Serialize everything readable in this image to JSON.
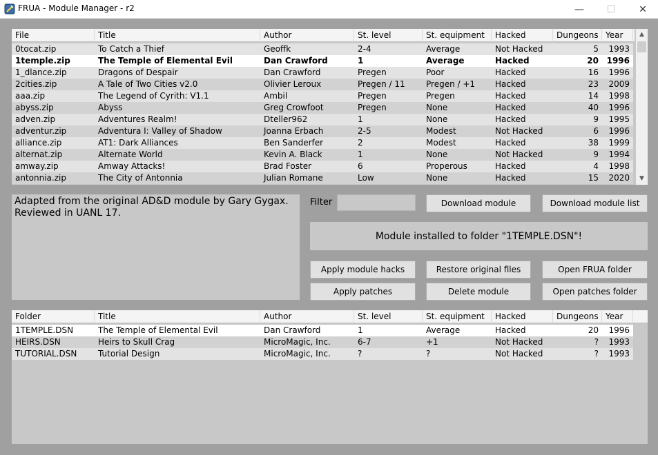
{
  "window": {
    "title": "FRUA - Module Manager - r2",
    "min_glyph": "—",
    "max_glyph": "☐",
    "close_glyph": "✕"
  },
  "modules": {
    "columns": [
      "File",
      "Title",
      "Author",
      "St. level",
      "St. equipment",
      "Hacked",
      "Dungeons",
      "Year"
    ],
    "selected_index": 1,
    "rows": [
      [
        "0tocat.zip",
        "To Catch a Thief",
        "Geoffk",
        "2-4",
        "Average",
        "Not Hacked",
        "5",
        "1993"
      ],
      [
        "1temple.zip",
        "The Temple of Elemental Evil",
        "Dan Crawford",
        "1",
        "Average",
        "Hacked",
        "20",
        "1996"
      ],
      [
        "1_dlance.zip",
        "Dragons of Despair",
        "Dan Crawford",
        "Pregen",
        "Poor",
        "Hacked",
        "16",
        "1996"
      ],
      [
        "2cities.zip",
        "A Tale of Two Cities v2.0",
        "Olivier Leroux",
        "Pregen / 11",
        "Pregen / +1",
        "Hacked",
        "23",
        "2009"
      ],
      [
        "aaa.zip",
        "The Legend of Cyrith: V1.1",
        "Ambil",
        "Pregen",
        "Pregen",
        "Hacked",
        "14",
        "1998"
      ],
      [
        "abyss.zip",
        "Abyss",
        "Greg Crowfoot",
        "Pregen",
        "None",
        "Hacked",
        "40",
        "1996"
      ],
      [
        "adven.zip",
        "Adventures Realm!",
        "Dteller962",
        "1",
        "None",
        "Hacked",
        "9",
        "1995"
      ],
      [
        "adventur.zip",
        "Adventura I: Valley of Shadow",
        "Joanna Erbach",
        "2-5",
        "Modest",
        "Not Hacked",
        "6",
        "1996"
      ],
      [
        "alliance.zip",
        "AT1: Dark Alliances",
        "Ben Sanderfer",
        "2",
        "Modest",
        "Hacked",
        "38",
        "1999"
      ],
      [
        "alternat.zip",
        "Alternate World",
        "Kevin A. Black",
        "1",
        "None",
        "Not Hacked",
        "9",
        "1994"
      ],
      [
        "amway.zip",
        "Amway Attacks!",
        "Brad Foster",
        "6",
        "Properous",
        "Hacked",
        "4",
        "1998"
      ],
      [
        "antonnia.zip",
        "The City of Antonnia",
        "Julian Romane",
        "Low",
        "None",
        "Hacked",
        "15",
        "2020"
      ]
    ]
  },
  "description": {
    "line1": "Adapted from the original AD&D module by Gary Gygax.",
    "line2": "Reviewed in UANL 17."
  },
  "filter": {
    "label": "Filter",
    "value": ""
  },
  "buttons": {
    "download_module": "Download module",
    "download_module_list": "Download module list",
    "apply_module_hacks": "Apply module hacks",
    "restore_original_files": "Restore original files",
    "open_frua_folder": "Open FRUA folder",
    "apply_patches": "Apply patches",
    "delete_module": "Delete module",
    "open_patches_folder": "Open patches folder"
  },
  "status": {
    "message": "Module installed to folder \"1TEMPLE.DSN\"!"
  },
  "installed": {
    "columns": [
      "Folder",
      "Title",
      "Author",
      "St. level",
      "St. equipment",
      "Hacked",
      "Dungeons",
      "Year"
    ],
    "selected_index": 0,
    "rows": [
      [
        "1TEMPLE.DSN",
        "The Temple of Elemental Evil",
        "Dan Crawford",
        "1",
        "Average",
        "Hacked",
        "20",
        "1996"
      ],
      [
        "HEIRS.DSN",
        "Heirs to Skull Crag",
        "MicroMagic, Inc.",
        "6-7",
        "+1",
        "Not Hacked",
        "?",
        "1993"
      ],
      [
        "TUTORIAL.DSN",
        "Tutorial Design",
        "MicroMagic, Inc.",
        "?",
        "?",
        "Not Hacked",
        "?",
        "1993"
      ]
    ]
  }
}
